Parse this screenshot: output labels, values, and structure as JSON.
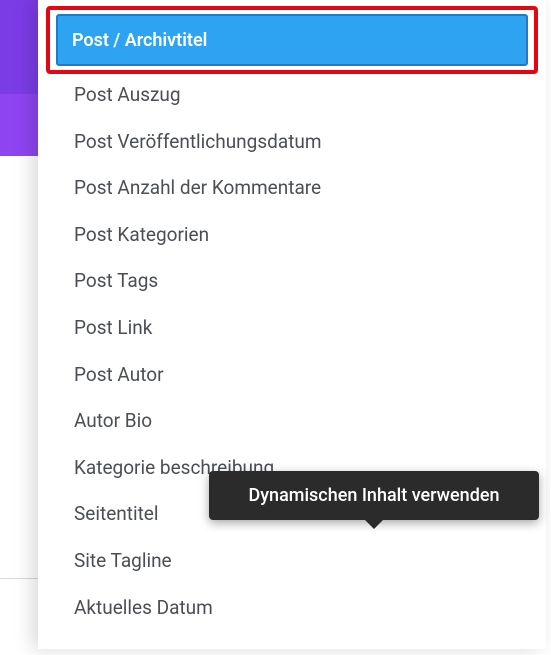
{
  "dropdown": {
    "selected_label": "Post / Archivtitel",
    "items": [
      "Post Auszug",
      "Post Veröffentlichungsdatum",
      "Post Anzahl der Kommentare",
      "Post Kategorien",
      "Post Tags",
      "Post Link",
      "Post Autor",
      "Autor Bio",
      "Kategorie beschreibung",
      "Seitentitel",
      "Site Tagline",
      "Aktuelles Datum"
    ]
  },
  "tooltip": {
    "text": "Dynamischen Inhalt verwenden"
  }
}
